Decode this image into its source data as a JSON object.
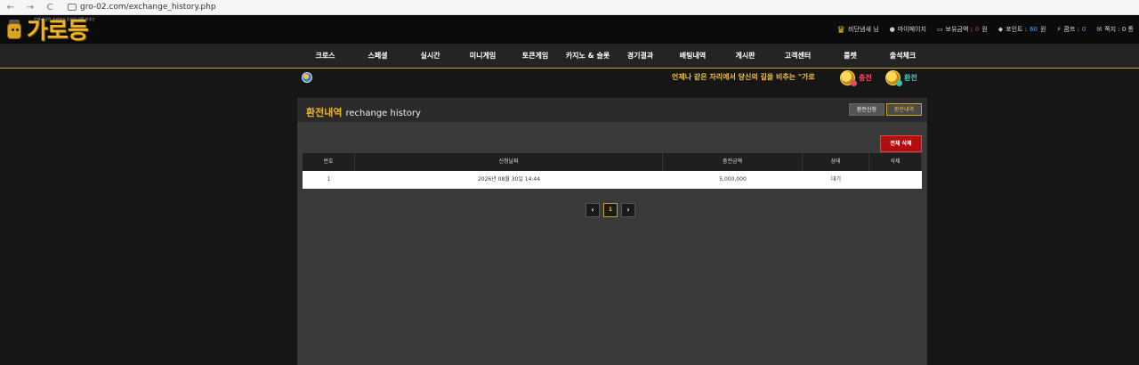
{
  "browser": {
    "back": "←",
    "forward": "→",
    "reload": "C",
    "url": "gro-02.com/exchange_history.php"
  },
  "logo": {
    "text": "가로등",
    "tagline": "언제나 같은 자리에서 당신의 길을 비추는"
  },
  "user_info": {
    "nickname": "비단냄새 님",
    "mypage": "마이페이지",
    "balance_label": "보유금액 :",
    "balance_value": "0",
    "balance_unit": "원",
    "points_label": "포인트 :",
    "points_value": "60",
    "points_unit": "원",
    "comp_label": "콤프 :",
    "comp_value": "0",
    "message_label": "쪽지 : 0 통"
  },
  "nav": {
    "items": [
      "크로스",
      "스페셜",
      "실시간",
      "미니게임",
      "토큰게임",
      "카지노 & 슬롯",
      "경기결과",
      "배팅내역",
      "게시판",
      "고객센터",
      "룰렛",
      "출석체크"
    ]
  },
  "notice": {
    "marquee": "언제나 같은 자리에서 당신의 길을 비추는 \"가로",
    "charge": "충전",
    "exchange": "환전"
  },
  "page": {
    "title": "환전내역",
    "subtitle": "rechange history",
    "tabs": [
      "환전신청",
      "환전내역"
    ],
    "delete_all": "전체 삭제"
  },
  "table": {
    "headers": [
      "번호",
      "신청날짜",
      "충전금액",
      "상태",
      "삭제"
    ],
    "rows": [
      [
        "1",
        "2026년 08월 30일 14:44",
        "5,000,000",
        "대기",
        ""
      ]
    ]
  },
  "pagination": {
    "prev": "‹",
    "current": "1",
    "next": "›"
  }
}
